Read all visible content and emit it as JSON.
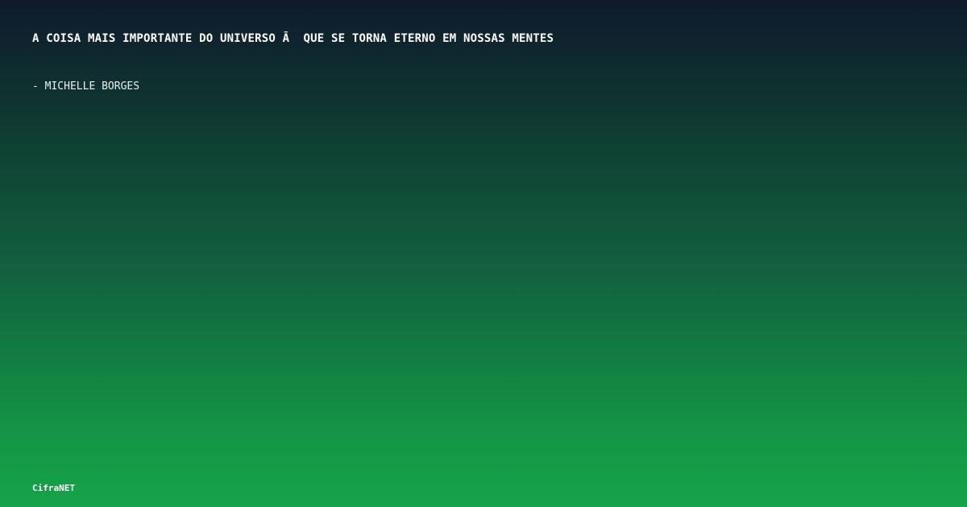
{
  "quote": {
    "text": "A COISA MAIS IMPORTANTE DO UNIVERSO Ã  QUE SE TORNA ETERNO EM NOSSAS MENTES",
    "author": "- MICHELLE BORGES"
  },
  "brand": {
    "name": "CifraNET"
  },
  "colors": {
    "background_top": "#0f1a2c",
    "background_bottom": "#16a34a",
    "text": "#ffffff"
  }
}
